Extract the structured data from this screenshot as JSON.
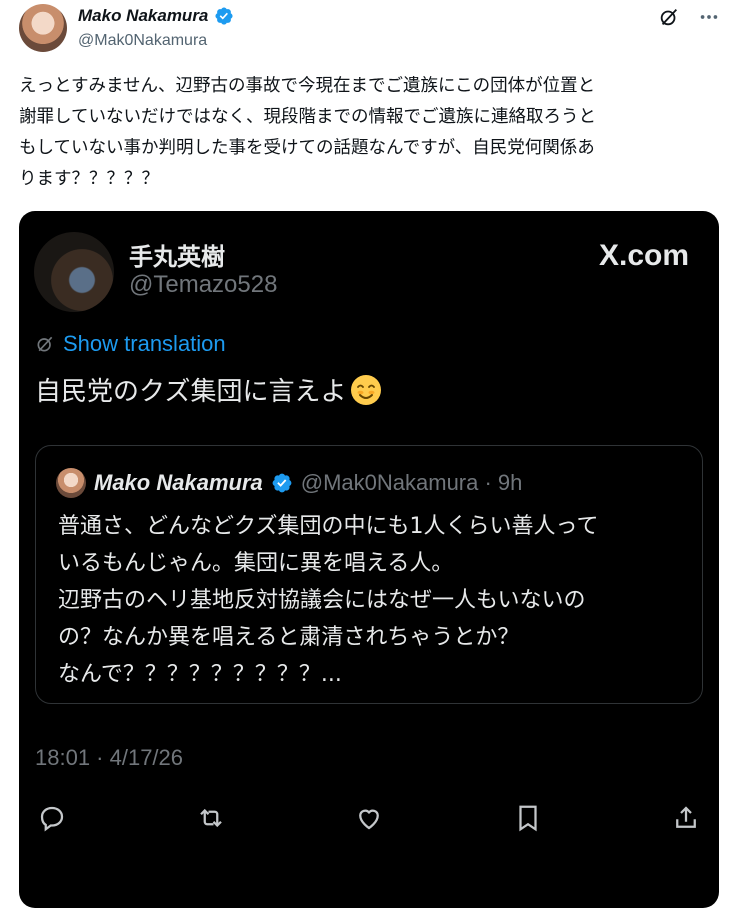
{
  "author": {
    "name": "Mako Nakamura",
    "handle": "@Mak0Nakamura"
  },
  "icons": {
    "verified": "verified-badge-icon",
    "grok": "grok-icon",
    "more": "more-icon",
    "translate": "translate-icon",
    "reply": "reply-icon",
    "retweet": "retweet-icon",
    "like": "like-icon",
    "bookmark": "bookmark-icon",
    "share": "share-icon"
  },
  "body": {
    "lines": [
      "えっとすみません、辺野古の事故で今現在までご遺族にこの団体が位置と",
      "謝罪していないだけではなく、現段階までの情報でご遺族に連絡取ろうと",
      "もしていない事か判明した事を受けての話題なんですが、自民党何関係あ",
      "ります？？？？？"
    ]
  },
  "embedded": {
    "name": "手丸英樹",
    "handle": "@Temazo528",
    "watermark": "X.com",
    "translate_label": "Show translation",
    "text": "自民党のクズ集団に言えよ",
    "emoji": "😊",
    "quote": {
      "name": "Mako Nakamura",
      "handle_time": "@Mak0Nakamura · 9h",
      "lines": [
        "普通さ、どんなどクズ集団の中にも1人くらい善人って",
        "いるもんじゃん。集団に異を唱える人。",
        "辺野古のヘリ基地反対協議会にはなぜ一人もいないの",
        "の？なんか異を唱えると粛清されちゃうとか？",
        "なんで？？？？？？？？？..."
      ]
    },
    "timestamp": "18:01 · 4/17/26"
  },
  "colors": {
    "verified": "#1d9bf0",
    "link": "#1d9bf0",
    "dark_bg": "#000000",
    "muted": "#71767b"
  }
}
